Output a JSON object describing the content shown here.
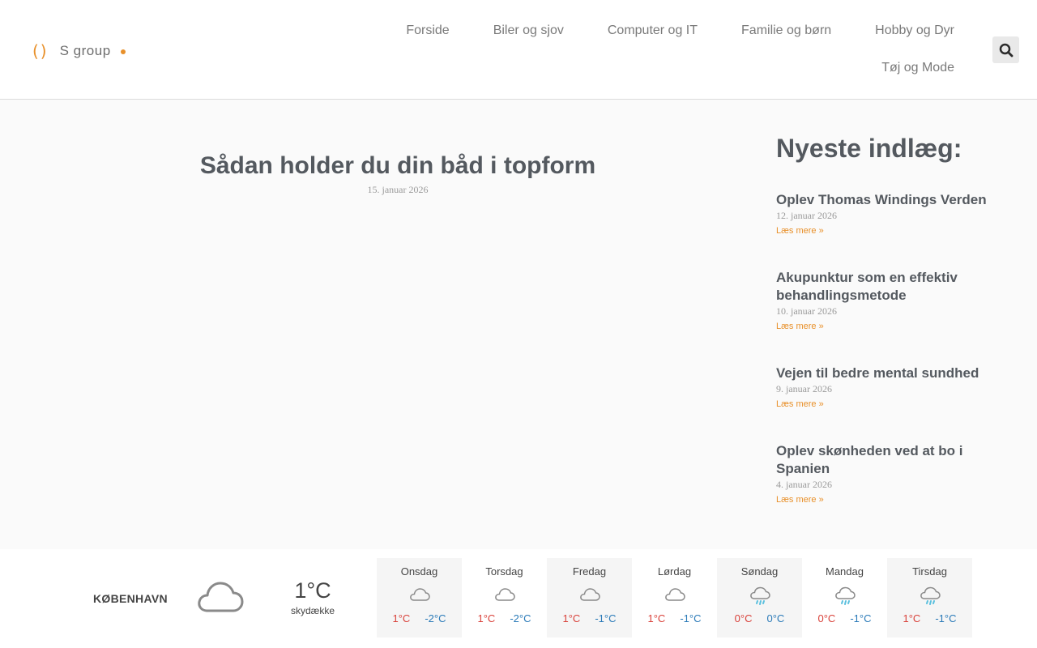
{
  "logo": {
    "mark": "()",
    "name": "S group"
  },
  "nav": {
    "items": [
      "Forside",
      "Biler og sjov",
      "Computer og IT",
      "Familie og børn",
      "Hobby og Dyr",
      "Tøj og Mode"
    ]
  },
  "article": {
    "title": "Sådan holder du din båd i topform",
    "date": "15. januar 2026"
  },
  "sidebar": {
    "heading": "Nyeste indlæg:",
    "posts": [
      {
        "title": "Oplev Thomas Windings Verden",
        "date": "12. januar 2026",
        "more": "Læs mere »"
      },
      {
        "title": "Akupunktur som en effektiv behandlingsmetode",
        "date": "10. januar 2026",
        "more": "Læs mere »"
      },
      {
        "title": "Vejen til bedre mental sundhed",
        "date": "9. januar 2026",
        "more": "Læs mere »"
      },
      {
        "title": "Oplev skønheden ved at bo i Spanien",
        "date": "4. januar 2026",
        "more": "Læs mere »"
      }
    ]
  },
  "weather": {
    "city": "KØBENHAVN",
    "current_icon": "cloud-icon",
    "current_temp": "1°C",
    "current_desc": "skydække",
    "days": [
      {
        "name": "Onsdag",
        "icon": "cloud-icon",
        "hi": "1°C",
        "lo": "-2°C"
      },
      {
        "name": "Torsdag",
        "icon": "cloud-icon",
        "hi": "1°C",
        "lo": "-2°C"
      },
      {
        "name": "Fredag",
        "icon": "cloud-icon",
        "hi": "1°C",
        "lo": "-1°C"
      },
      {
        "name": "Lørdag",
        "icon": "cloud-icon",
        "hi": "1°C",
        "lo": "-1°C"
      },
      {
        "name": "Søndag",
        "icon": "rain-cloud-icon",
        "hi": "0°C",
        "lo": "0°C"
      },
      {
        "name": "Mandag",
        "icon": "rain-cloud-icon",
        "hi": "0°C",
        "lo": "-1°C"
      },
      {
        "name": "Tirsdag",
        "icon": "rain-cloud-icon",
        "hi": "1°C",
        "lo": "-1°C"
      }
    ]
  },
  "colors": {
    "accent": "#e8902a",
    "text": "#54595f",
    "hot": "#d9413a",
    "cold": "#2a7ab8",
    "rain": "#5bc0de"
  }
}
